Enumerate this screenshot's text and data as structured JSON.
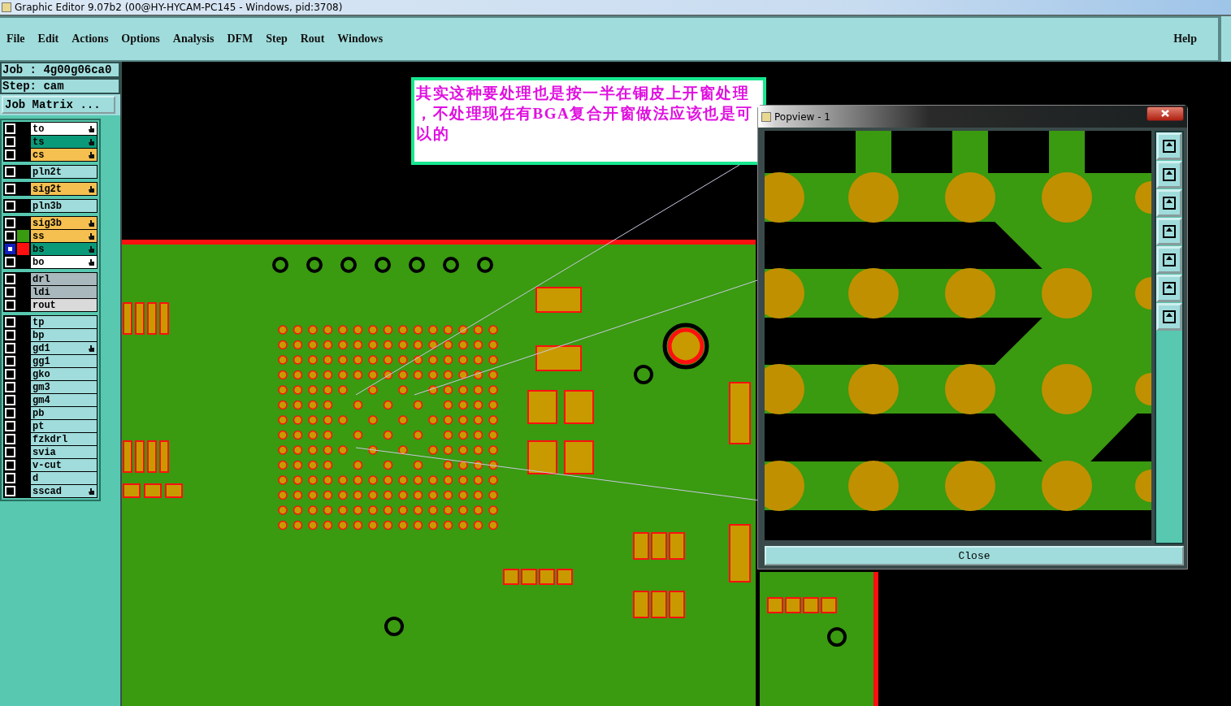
{
  "window": {
    "title": "Graphic Editor 9.07b2 (00@HY-HYCAM-PC145 - Windows, pid:3708)"
  },
  "menu": [
    {
      "label": "File"
    },
    {
      "label": "Edit"
    },
    {
      "label": "Actions"
    },
    {
      "label": "Options"
    },
    {
      "label": "Analysis"
    },
    {
      "label": "DFM"
    },
    {
      "label": "Step"
    },
    {
      "label": "Rout"
    },
    {
      "label": "Windows"
    }
  ],
  "help": "Help",
  "job": {
    "job": "Job : 4g00g06ca0",
    "step": "Step: cam",
    "matrix_button": "Job Matrix ..."
  },
  "layer_groups": [
    [
      {
        "name": "to",
        "kind": "silk",
        "affected": true,
        "selected": false
      },
      {
        "name": "ts",
        "kind": "mask",
        "affected": true,
        "selected": false
      },
      {
        "name": "cs",
        "kind": "signal",
        "affected": true,
        "selected": false
      }
    ],
    [
      {
        "name": "pln2t",
        "kind": "document",
        "affected": false,
        "selected": false
      }
    ],
    [
      {
        "name": "sig2t",
        "kind": "signal",
        "affected": true,
        "selected": false
      }
    ],
    [
      {
        "name": "pln3b",
        "kind": "document",
        "affected": false,
        "selected": false
      }
    ],
    [
      {
        "name": "sig3b",
        "kind": "signal",
        "affected": true,
        "selected": false
      },
      {
        "name": "ss",
        "kind": "signal",
        "affected": true,
        "selected": false,
        "color": "#3a9a10"
      },
      {
        "name": "bs",
        "kind": "mask",
        "affected": true,
        "selected": true,
        "color": "#ff1010"
      },
      {
        "name": "bo",
        "kind": "silk",
        "affected": true,
        "selected": false
      }
    ],
    [
      {
        "name": "drl",
        "kind": "drill",
        "affected": false,
        "selected": false
      },
      {
        "name": "ldi",
        "kind": "drill",
        "affected": false,
        "selected": false
      },
      {
        "name": "rout",
        "kind": "rout",
        "affected": false,
        "selected": false
      }
    ],
    [
      {
        "name": "tp",
        "kind": "document",
        "affected": false,
        "selected": false
      },
      {
        "name": "bp",
        "kind": "document",
        "affected": false,
        "selected": false
      },
      {
        "name": "gd1",
        "kind": "document",
        "affected": true,
        "selected": false
      },
      {
        "name": "gg1",
        "kind": "document",
        "affected": false,
        "selected": false
      },
      {
        "name": "gko",
        "kind": "document",
        "affected": false,
        "selected": false
      },
      {
        "name": "gm3",
        "kind": "document",
        "affected": false,
        "selected": false
      },
      {
        "name": "gm4",
        "kind": "document",
        "affected": false,
        "selected": false
      },
      {
        "name": "pb",
        "kind": "document",
        "affected": false,
        "selected": false
      },
      {
        "name": "pt",
        "kind": "document",
        "affected": false,
        "selected": false
      },
      {
        "name": "fzkdrl",
        "kind": "document",
        "affected": false,
        "selected": false
      },
      {
        "name": "svia",
        "kind": "document",
        "affected": false,
        "selected": false
      },
      {
        "name": "v-cut",
        "kind": "document",
        "affected": false,
        "selected": false
      },
      {
        "name": "d",
        "kind": "document",
        "affected": false,
        "selected": false
      },
      {
        "name": "sscad",
        "kind": "document",
        "affected": true,
        "selected": false
      }
    ]
  ],
  "annotation": {
    "text": "其实这种要处理也是按一半在铜皮上开窗处理，不处理现在有BGA复合开窗做法应该也是可以的"
  },
  "popview": {
    "title": "Popview - 1",
    "close": "Close"
  }
}
